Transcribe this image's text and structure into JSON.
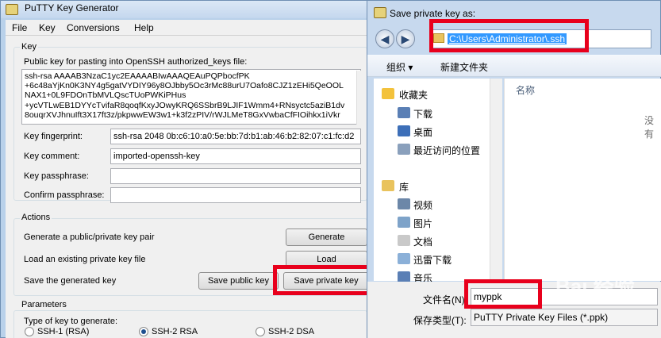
{
  "putty": {
    "title": "PuTTY Key Generator",
    "menu": [
      "File",
      "Key",
      "Conversions",
      "Help"
    ],
    "key_group": "Key",
    "public_key_label": "Public key for pasting into OpenSSH authorized_keys file:",
    "public_key_lines": [
      "ssh-rsa AAAAB3NzaC1yc2EAAAABIwAAAQEAuPQPbocfPK",
      "+6c48aYjKn0K3NY4g5gatVYDIY96y8OJbby5Oc3rMc88urU7Oafo8CJZ1zEHi5QeOOL",
      "NAX1+0L9FDOnTbMVLQscTUoPWKiPHus",
      "+ycVTLwEB1DYYcTvifaR8qoqfKxyJOwyKRQ6SSbrB9LJIF1Wmm4+RNsyctc5aziB1dv",
      "8ouqrXVJhnuIft3X17ft3z/pkpwwEW3w1+k3f2zPIV/rWJLMeT8GxVwbaCfFIOihkx1iVkr"
    ],
    "fingerprint_label": "Key fingerprint:",
    "fingerprint_value": "ssh-rsa 2048 0b:c6:10:a0:5e:bb:7d:b1:ab:46:b2:82:07:c1:fc:d2",
    "comment_label": "Key comment:",
    "comment_value": "imported-openssh-key",
    "passphrase_label": "Key passphrase:",
    "confirm_label": "Confirm passphrase:",
    "actions_group": "Actions",
    "generate_label": "Generate a public/private key pair",
    "generate_btn": "Generate",
    "load_label": "Load an existing private key file",
    "load_btn": "Load",
    "save_label": "Save the generated key",
    "save_public_btn": "Save public key",
    "save_private_btn": "Save private key",
    "params_group": "Parameters",
    "type_label": "Type of key to generate:",
    "radio_ssh1": "SSH-1 (RSA)",
    "radio_ssh2rsa": "SSH-2 RSA",
    "radio_ssh2dsa": "SSH-2 DSA"
  },
  "dialog": {
    "title": "Save private key as:",
    "address": "C:\\Users\\Administrator\\.ssh",
    "organize": "组织 ▾",
    "new_folder": "新建文件夹",
    "tree": [
      "收藏夹",
      "下载",
      "桌面",
      "最近访问的位置",
      "库",
      "视频",
      "图片",
      "文档",
      "迅雷下载",
      "音乐"
    ],
    "col_name": "名称",
    "empty": "没有",
    "filename_label": "文件名(N):",
    "filename_value": "myppk",
    "filetype_label": "保存类型(T):",
    "filetype_value": "PuTTY Private Key Files (*.ppk)"
  },
  "watermark": "Bai 经验"
}
